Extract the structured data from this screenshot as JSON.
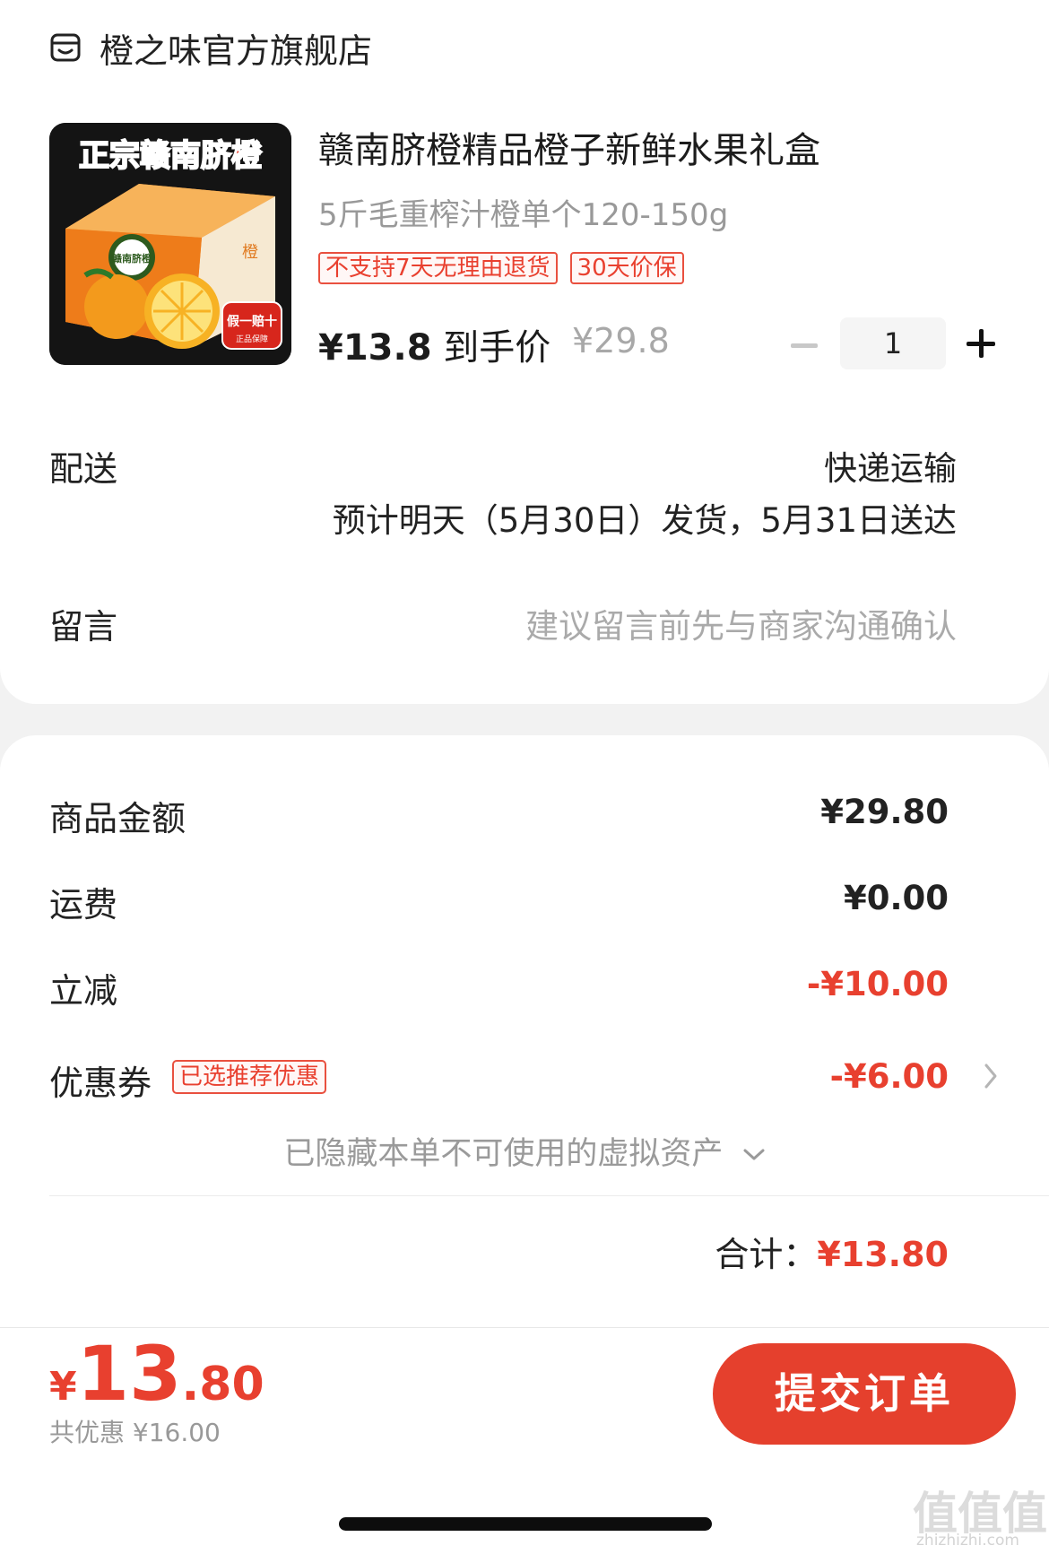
{
  "shop": {
    "name": "橙之味官方旗舰店",
    "icon": "store-icon"
  },
  "product": {
    "image_texts": {
      "banner": "正宗赣南脐橙",
      "badge_main": "假一赔十",
      "badge_sub": "正品保障",
      "box_label": "赣南脐橙"
    },
    "title": "赣南脐橙精品橙子新鲜水果礼盒",
    "spec": "5斤毛重榨汁橙单个120-150g",
    "tags": [
      "不支持7天无理由退货",
      "30天价保"
    ],
    "final_price": "¥13.8",
    "final_price_label": "到手价",
    "original_price": "¥29.8",
    "quantity": "1"
  },
  "delivery": {
    "label": "配送",
    "method": "快递运输",
    "eta": "预计明天（5月30日）发货，5月31日送达"
  },
  "note": {
    "label": "留言",
    "placeholder": "建议留言前先与商家沟通确认"
  },
  "summary": {
    "goods_label": "商品金额",
    "goods_value": "¥29.80",
    "shipping_label": "运费",
    "shipping_value": "¥0.00",
    "discount_label": "立减",
    "discount_value": "-¥10.00",
    "coupon_label": "优惠券",
    "coupon_tag": "已选推荐优惠",
    "coupon_value": "-¥6.00",
    "hidden_assets": "已隐藏本单不可使用的虚拟资产",
    "total_label": "合计：",
    "total_value": "¥13.80"
  },
  "footer": {
    "currency": "¥",
    "price_int": "13",
    "price_dec": ".80",
    "saved": "共优惠 ¥16.00",
    "submit_label": "提交订单"
  },
  "watermark": {
    "main": "值值值",
    "sub": "zhizhizhi.com"
  },
  "colors": {
    "accent": "#e5402d",
    "price_red": "#e8402f",
    "muted": "#999999"
  }
}
